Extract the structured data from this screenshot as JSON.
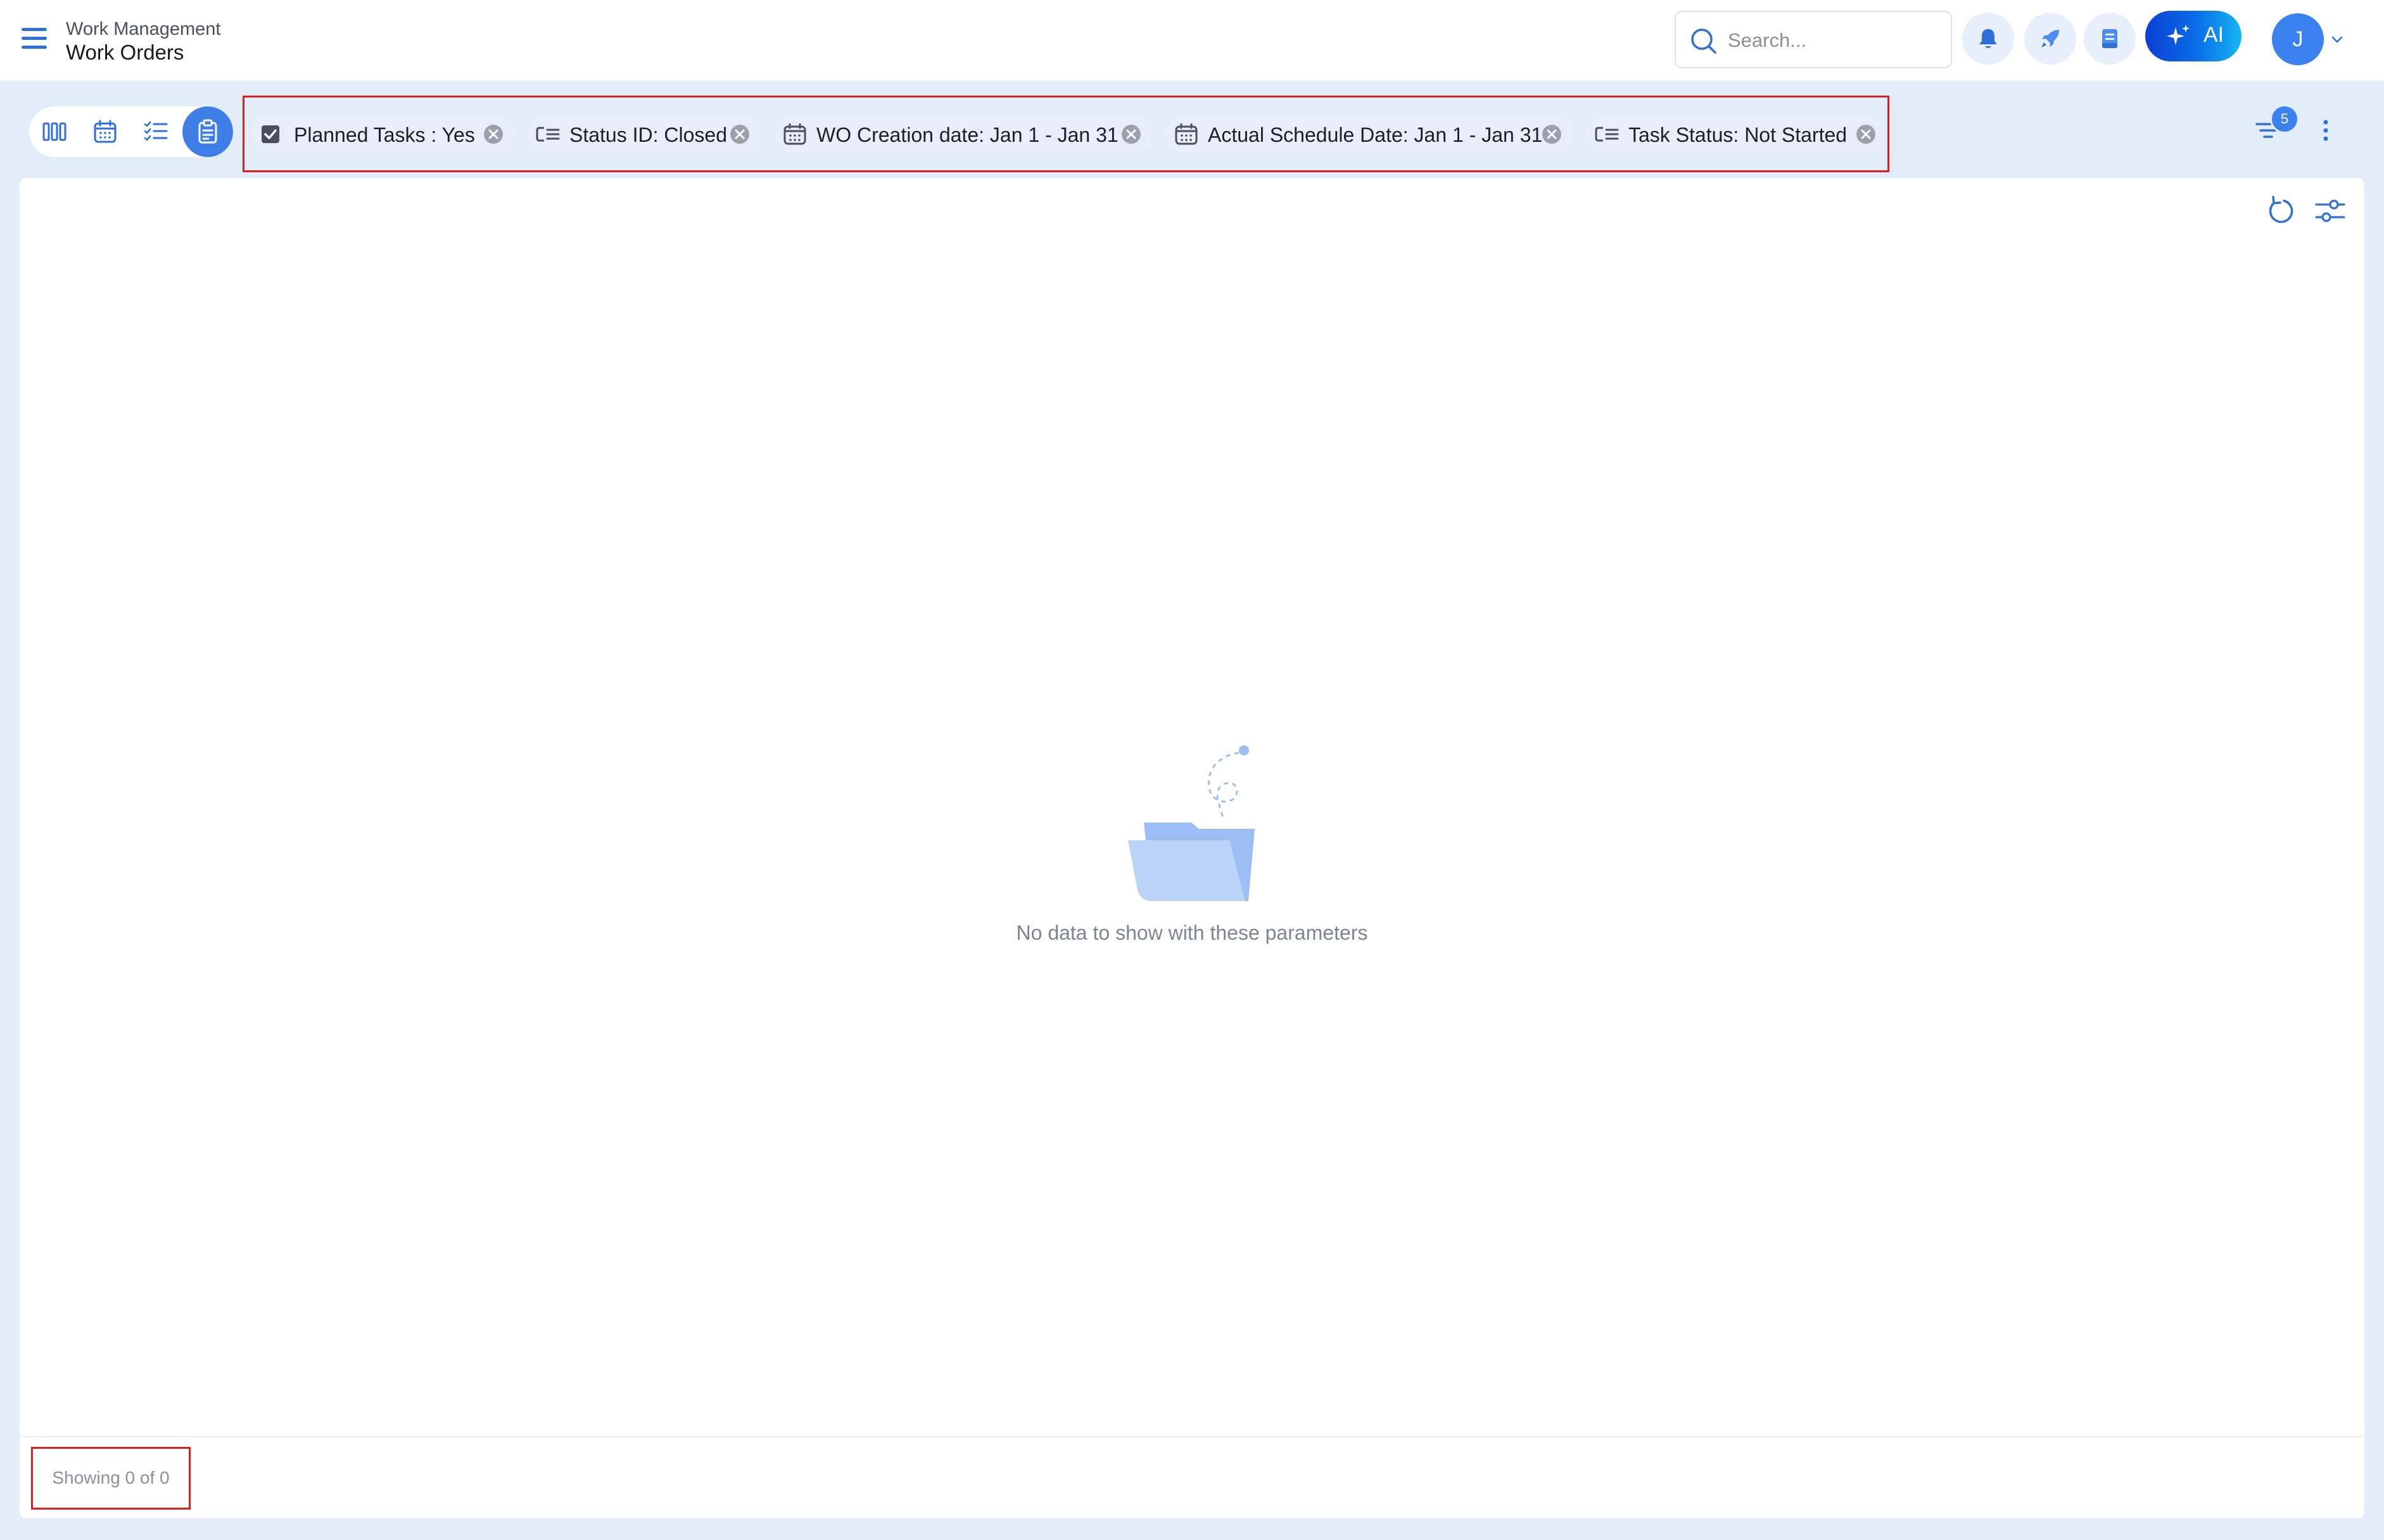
{
  "header": {
    "module": "Work Management",
    "page_title": "Work Orders",
    "search_placeholder": "Search...",
    "ai_label": "AI",
    "avatar_initial": "J"
  },
  "filters": {
    "count": "5",
    "chips": [
      {
        "label": "Planned Tasks : Yes",
        "icon": "checkbox-checked-icon"
      },
      {
        "label": "Status ID: Closed",
        "icon": "list-filter-icon"
      },
      {
        "label": "WO Creation date: Jan 1 - Jan 31",
        "icon": "calendar-icon"
      },
      {
        "label": "Actual Schedule Date: Jan 1 - Jan 31",
        "icon": "calendar-icon"
      },
      {
        "label": "Task Status: Not Started",
        "icon": "list-filter-icon"
      }
    ]
  },
  "views": {
    "active": "clipboard-view"
  },
  "main": {
    "empty_message": "No data to show with these parameters",
    "showing": "Showing 0 of 0"
  },
  "colors": {
    "accent": "#3e7ee6",
    "highlight_border": "#e01c1c",
    "page_bg": "#e3edfa"
  }
}
